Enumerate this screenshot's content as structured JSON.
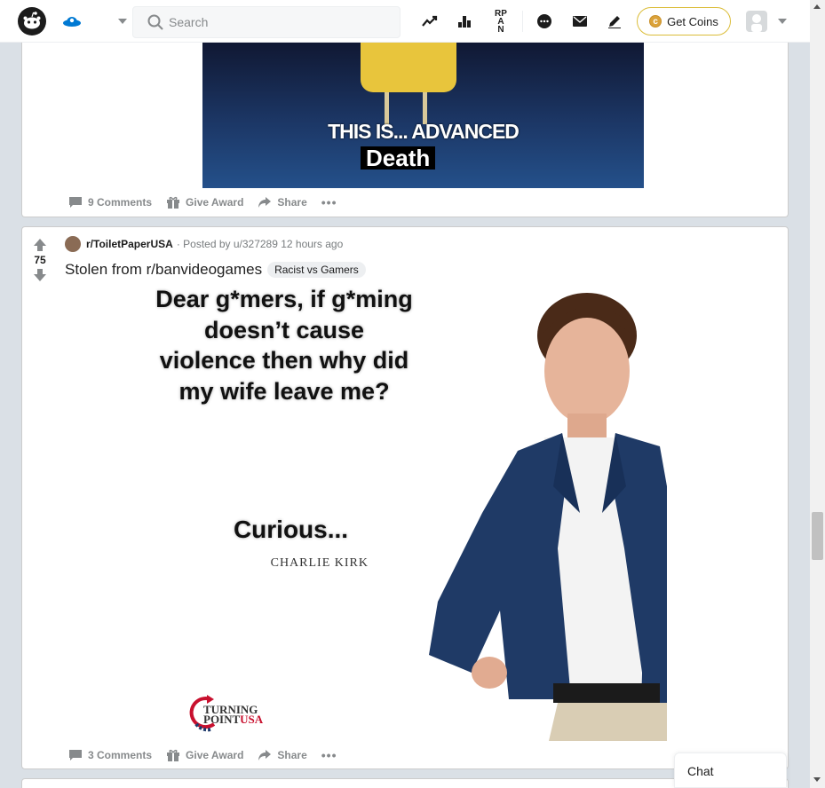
{
  "header": {
    "search_placeholder": "Search",
    "get_coins_label": "Get Coins",
    "coin_symbol": "c",
    "icons": [
      "reddit-logo-icon",
      "community-icon",
      "popular-trend-icon",
      "stats-icon",
      "rpan-icon",
      "chat-icon",
      "mail-icon",
      "create-post-icon",
      "coin-icon",
      "user-avatar-icon"
    ],
    "rpan_label": "RP AN"
  },
  "post1": {
    "meme_caption_line1": "THIS IS... ADVANCED",
    "meme_caption_line2": "Death",
    "comments_label": "9 Comments",
    "award_label": "Give Award",
    "share_label": "Share",
    "more_label": "•••"
  },
  "post2": {
    "score": "75",
    "subreddit": "r/ToiletPaperUSA",
    "posted_by": "· Posted by u/327289 12 hours ago",
    "title": "Stolen from r/banvideogames",
    "flair": "Racist vs Gamers",
    "meme": {
      "quote": "Dear g*mers, if g*ming doesn’t cause violence then why did my wife leave me?",
      "closing": "Curious...",
      "attribution": "CHARLIE KIRK",
      "logo_line1": "TURNING",
      "logo_line2": "POINT",
      "logo_line3": "USA"
    },
    "comments_label": "3 Comments",
    "award_label": "Give Award",
    "share_label": "Share",
    "more_label": "•••"
  },
  "chat": {
    "label": "Chat"
  },
  "colors": {
    "accent": "#0079d3",
    "coin_border": "#dbbd39",
    "background": "#dae0e6"
  }
}
